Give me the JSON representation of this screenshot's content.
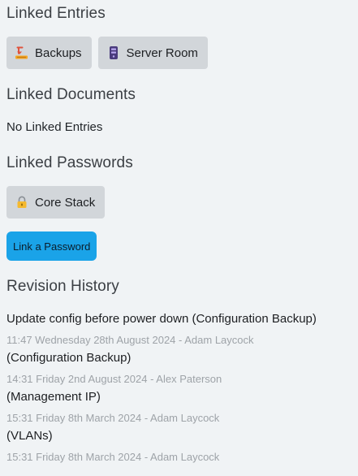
{
  "linked_entries": {
    "title": "Linked Entries",
    "items": [
      {
        "label": "Backups",
        "icon": "backup-icon"
      },
      {
        "label": "Server Room",
        "icon": "server-icon"
      }
    ]
  },
  "linked_documents": {
    "title": "Linked Documents",
    "empty_text": "No Linked Entries"
  },
  "linked_passwords": {
    "title": "Linked Passwords",
    "items": [
      {
        "label": "Core Stack",
        "icon": "lock-icon"
      }
    ],
    "link_button": "Link a Password"
  },
  "revision_history": {
    "title": "Revision History",
    "items": [
      {
        "title": "Update config before power down (Configuration Backup)",
        "meta": "11:47 Wednesday 28th August 2024 - Adam Laycock"
      },
      {
        "title": "(Configuration Backup)",
        "meta": "14:31 Friday 2nd August 2024 - Alex Paterson"
      },
      {
        "title": "(Management IP)",
        "meta": "15:31 Friday 8th March 2024 - Adam Laycock"
      },
      {
        "title": "(VLANs)",
        "meta": "15:31 Friday 8th March 2024 - Adam Laycock"
      }
    ]
  },
  "colors": {
    "background": "#f0f3f5",
    "chip": "#d2d6da",
    "accent_button": "#1aa3e8",
    "meta_text": "#9ea3a8"
  }
}
